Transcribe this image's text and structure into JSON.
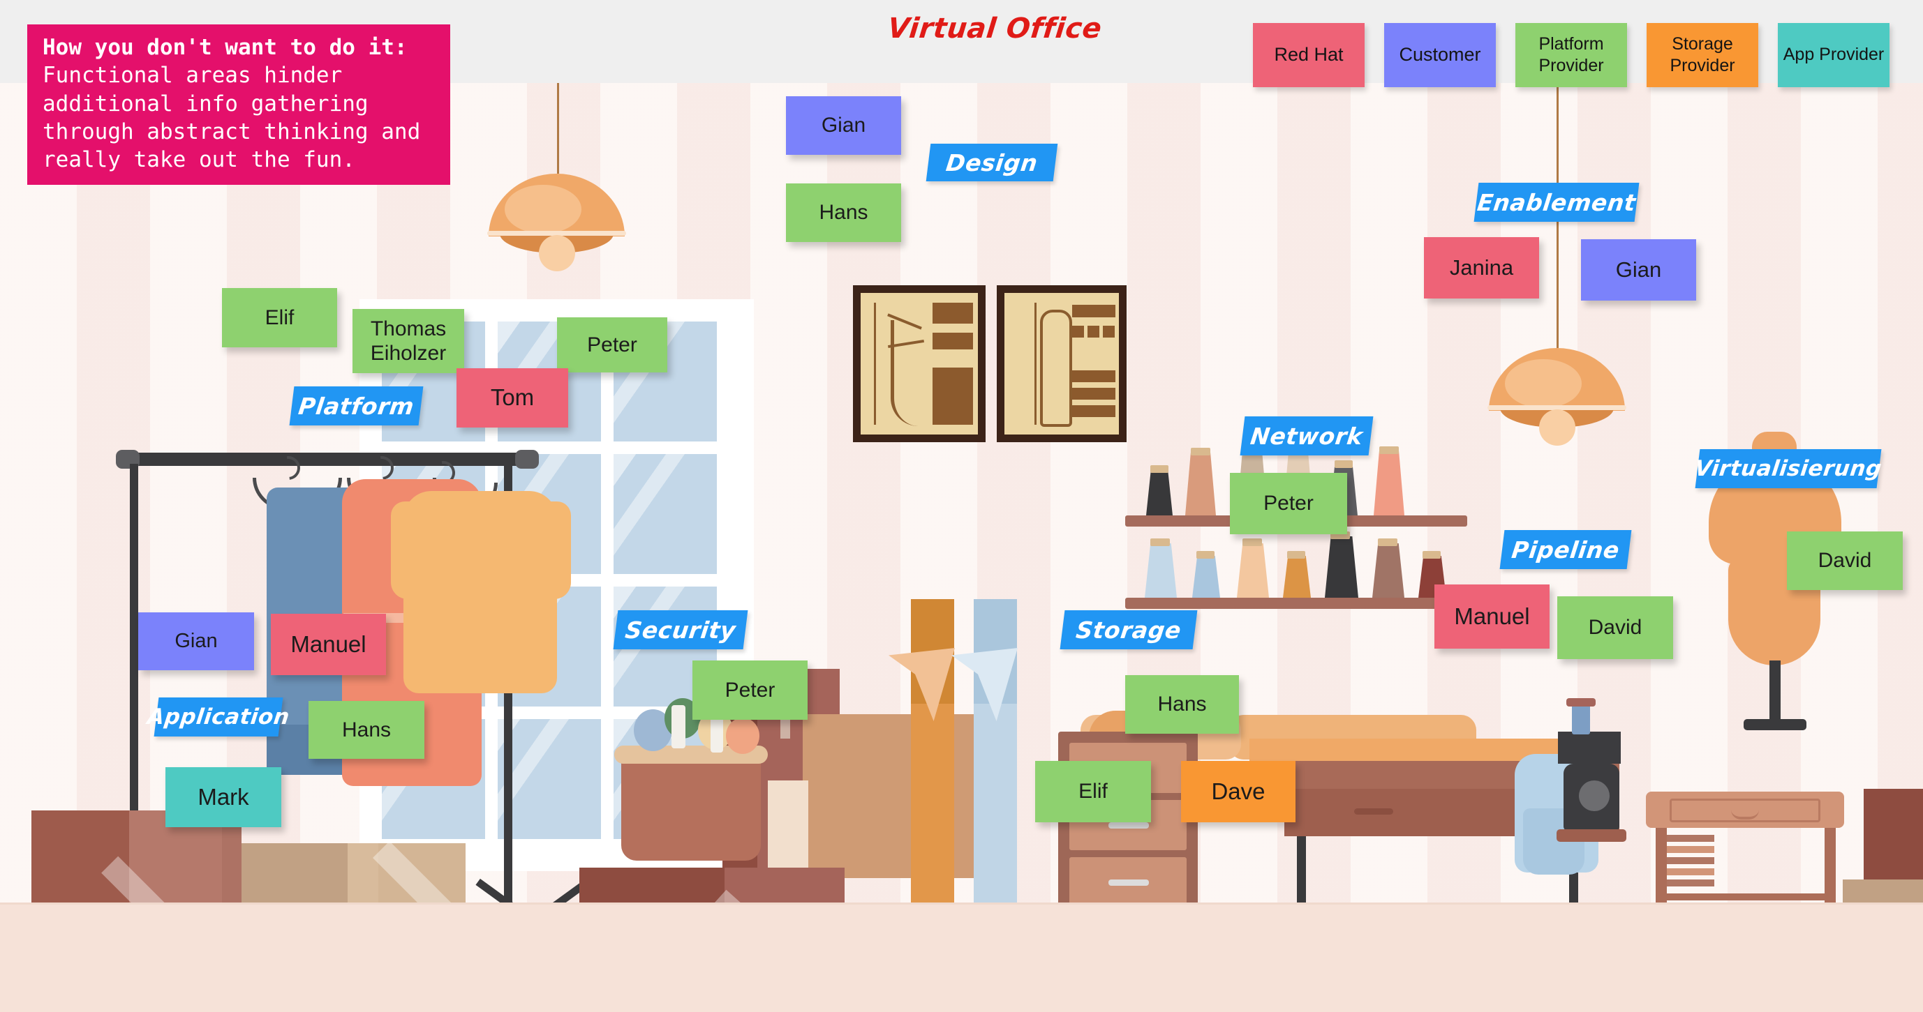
{
  "header": {
    "board_title": "Virtual Office",
    "title_color": "#e01b17",
    "band_color": "#efefef"
  },
  "callout": {
    "heading": "How you don't want to do it:",
    "body_lines": [
      "Functional areas hinder",
      "additional info gathering",
      "through abstract thinking and",
      "really take out the fun."
    ],
    "bg_color": "#e4106b",
    "text_color": "#ffffff"
  },
  "legend": {
    "items": [
      {
        "label": "Red Hat",
        "color": "#ee6377",
        "lines": 1
      },
      {
        "label": "Customer",
        "color": "#7b82fb",
        "lines": 1
      },
      {
        "label": "Platform Provider",
        "color": "#8ed16f",
        "lines": 2
      },
      {
        "label": "Storage Provider",
        "color": "#f99733",
        "lines": 2
      },
      {
        "label": "App Provider",
        "color": "#4ecac2",
        "lines": 2
      }
    ]
  },
  "palette": {
    "redhat": "#ee6377",
    "customer": "#7b82fb",
    "platform_provider": "#8ed16f",
    "storage_provider": "#f99733",
    "app_provider": "#4ecac2",
    "area_label": "#2196f3",
    "wall_light": "#fdf7f4",
    "wall_dark": "#f9ebe7",
    "floor": "#f6e2d8"
  },
  "area_labels": [
    {
      "name": "platform",
      "text": "Platform"
    },
    {
      "name": "application",
      "text": "Application"
    },
    {
      "name": "security",
      "text": "Security"
    },
    {
      "name": "design",
      "text": "Design"
    },
    {
      "name": "network",
      "text": "Network"
    },
    {
      "name": "storage",
      "text": "Storage"
    },
    {
      "name": "pipeline",
      "text": "Pipeline"
    },
    {
      "name": "enablement",
      "text": "Enablement"
    },
    {
      "name": "virtualisierung",
      "text": "Virtualisierung"
    }
  ],
  "notes": {
    "platform_elif": {
      "text": "Elif",
      "color": "#8ed16f",
      "role": "Platform Provider"
    },
    "platform_thomas": {
      "text": "Thomas Eiholzer",
      "color": "#8ed16f",
      "role": "Platform Provider"
    },
    "platform_peter": {
      "text": "Peter",
      "color": "#8ed16f",
      "role": "Platform Provider"
    },
    "platform_tom": {
      "text": "Tom",
      "color": "#ee6377",
      "role": "Red Hat"
    },
    "application_gian": {
      "text": "Gian",
      "color": "#7b82fb",
      "role": "Customer"
    },
    "application_manuel": {
      "text": "Manuel",
      "color": "#ee6377",
      "role": "Red Hat"
    },
    "application_hans": {
      "text": "Hans",
      "color": "#8ed16f",
      "role": "Platform Provider"
    },
    "application_mark": {
      "text": "Mark",
      "color": "#4ecac2",
      "role": "App Provider"
    },
    "security_peter": {
      "text": "Peter",
      "color": "#8ed16f",
      "role": "Platform Provider"
    },
    "design_gian": {
      "text": "Gian",
      "color": "#7b82fb",
      "role": "Customer"
    },
    "design_hans": {
      "text": "Hans",
      "color": "#8ed16f",
      "role": "Platform Provider"
    },
    "network_peter": {
      "text": "Peter",
      "color": "#8ed16f",
      "role": "Platform Provider"
    },
    "storage_hans": {
      "text": "Hans",
      "color": "#8ed16f",
      "role": "Platform Provider"
    },
    "storage_elif": {
      "text": "Elif",
      "color": "#8ed16f",
      "role": "Platform Provider"
    },
    "storage_dave": {
      "text": "Dave",
      "color": "#f99733",
      "role": "Storage Provider"
    },
    "pipeline_manuel": {
      "text": "Manuel",
      "color": "#ee6377",
      "role": "Red Hat"
    },
    "pipeline_david": {
      "text": "David",
      "color": "#8ed16f",
      "role": "Platform Provider"
    },
    "enablement_janina": {
      "text": "Janina",
      "color": "#ee6377",
      "role": "Red Hat"
    },
    "enablement_gian": {
      "text": "Gian",
      "color": "#7b82fb",
      "role": "Customer"
    },
    "virtualisierung_david": {
      "text": "David",
      "color": "#8ed16f",
      "role": "Platform Provider"
    }
  }
}
